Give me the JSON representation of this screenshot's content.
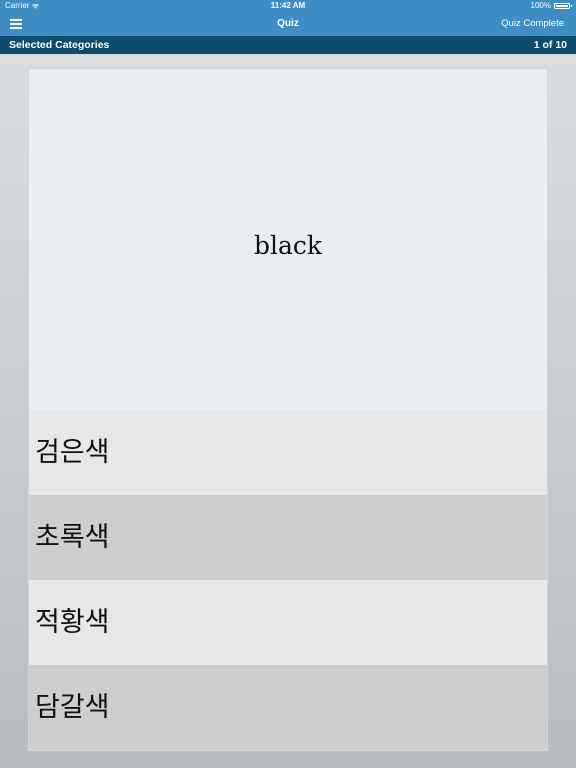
{
  "status_bar": {
    "carrier": "Carrier",
    "time": "11:42 AM",
    "battery": "100%"
  },
  "nav": {
    "title": "Quiz",
    "right_action": "Quiz Complete"
  },
  "category_bar": {
    "label": "Selected Categories",
    "progress": "1 of 10"
  },
  "quiz": {
    "question": "black",
    "answers": [
      {
        "text": "검은색"
      },
      {
        "text": "초록색"
      },
      {
        "text": "적황색"
      },
      {
        "text": "담갈색"
      }
    ]
  },
  "colors": {
    "nav_blue": "#3e8dc4",
    "category_navy": "#0d4a6b",
    "question_bg": "#eaeef0",
    "answer_light": "#e6e7e8",
    "answer_dark": "#cdcecf"
  },
  "icons": {
    "menu": "hamburger-menu-icon",
    "wifi": "wifi-icon",
    "battery": "battery-icon"
  }
}
